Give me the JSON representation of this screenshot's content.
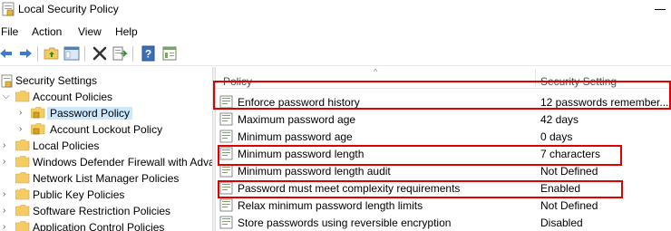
{
  "window": {
    "title": "Local Security Policy"
  },
  "menu": [
    "File",
    "Action",
    "View",
    "Help"
  ],
  "toolbar": {
    "icons": [
      "back-arrow-icon",
      "forward-arrow-icon",
      "up-folder-icon",
      "show-hide-tree-icon",
      "delete-icon",
      "export-list-icon",
      "help-icon",
      "properties-icon"
    ]
  },
  "tree": {
    "items": [
      {
        "label": "Security Settings",
        "expanded": true
      },
      {
        "label": "Account Policies",
        "expanded": true
      },
      {
        "label": "Password Policy",
        "selected": true
      },
      {
        "label": "Account Lockout Policy"
      },
      {
        "label": "Local Policies"
      },
      {
        "label": "Windows Defender Firewall with Adva"
      },
      {
        "label": "Network List Manager Policies"
      },
      {
        "label": "Public Key Policies"
      },
      {
        "label": "Software Restriction Policies"
      },
      {
        "label": "Application Control Policies"
      }
    ]
  },
  "list": {
    "columns": [
      "Policy",
      "Security Setting"
    ],
    "rows": [
      {
        "policy": "Enforce password history",
        "setting": "12 passwords remember...",
        "highlighted": true
      },
      {
        "policy": "Maximum password age",
        "setting": "42 days"
      },
      {
        "policy": "Minimum password age",
        "setting": "0 days"
      },
      {
        "policy": "Minimum password length",
        "setting": "7 characters",
        "highlighted": true
      },
      {
        "policy": "Minimum password length audit",
        "setting": "Not Defined"
      },
      {
        "policy": "Password must meet complexity requirements",
        "setting": "Enabled",
        "highlighted": true
      },
      {
        "policy": "Relax minimum password length limits",
        "setting": "Not Defined"
      },
      {
        "policy": "Store passwords using reversible encryption",
        "setting": "Disabled"
      }
    ]
  },
  "colors": {
    "highlight_box": "#e00000",
    "selection": "#cce8ff",
    "folder": "#f5cc62"
  }
}
